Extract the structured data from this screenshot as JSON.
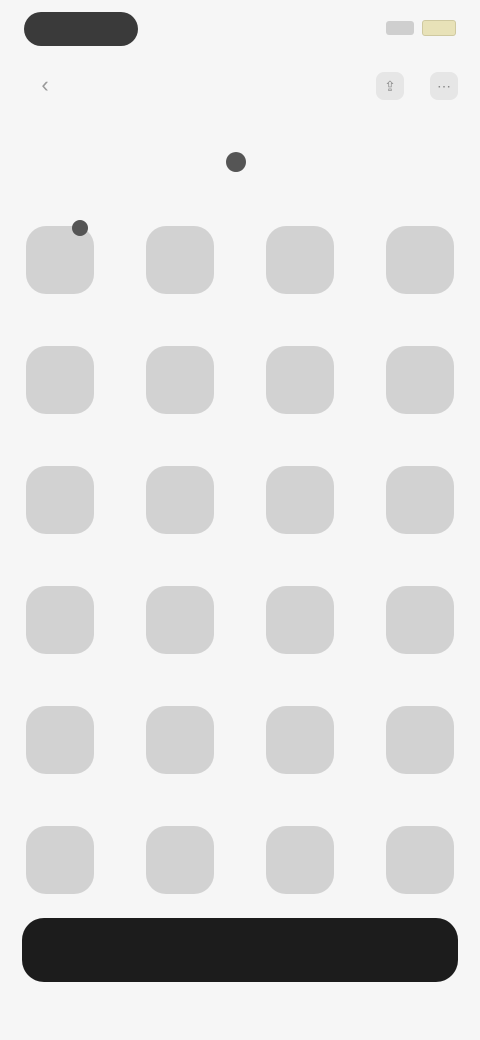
{
  "status": {
    "time": ""
  },
  "header": {
    "title": "",
    "back_icon": "back-arrow-icon",
    "icons": [
      "share-icon",
      "more-icon"
    ]
  },
  "subheader": {
    "label": "",
    "icon": "add-icon"
  },
  "grid": {
    "items": [
      {
        "label": ""
      },
      {
        "label": ""
      },
      {
        "label": ""
      },
      {
        "label": ""
      },
      {
        "label": ""
      },
      {
        "label": ""
      },
      {
        "label": ""
      },
      {
        "label": ""
      },
      {
        "label": ""
      },
      {
        "label": ""
      },
      {
        "label": ""
      },
      {
        "label": ""
      },
      {
        "label": ""
      },
      {
        "label": ""
      },
      {
        "label": ""
      },
      {
        "label": ""
      },
      {
        "label": ""
      },
      {
        "label": ""
      },
      {
        "label": ""
      },
      {
        "label": ""
      },
      {
        "label": ""
      },
      {
        "label": ""
      },
      {
        "label": ""
      },
      {
        "label": ""
      }
    ]
  },
  "bottom_button": {
    "label": ""
  }
}
